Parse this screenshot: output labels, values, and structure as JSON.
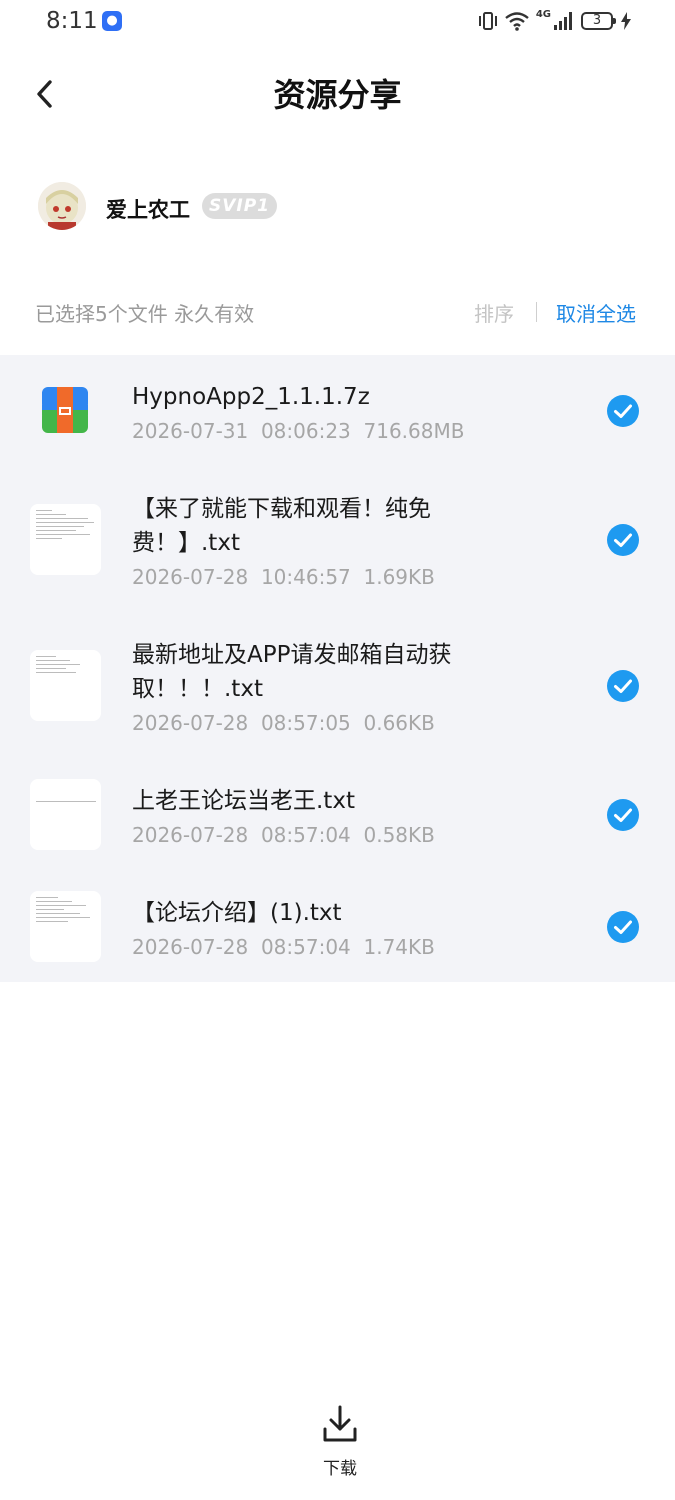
{
  "status_bar": {
    "time": "8:11",
    "network": "4G",
    "battery": "3"
  },
  "header": {
    "title": "资源分享"
  },
  "user": {
    "name": "爱上农工",
    "badge": "SVIP1"
  },
  "selection": {
    "summary": "已选择5个文件 永久有效",
    "sort_label": "排序",
    "deselect_label": "取消全选"
  },
  "files": [
    {
      "name": "HypnoApp2_1.1.1.7z",
      "date": "2026-07-31",
      "time": "08:06:23",
      "size": "716.68MB",
      "type": "archive",
      "selected": true
    },
    {
      "name": "【来了就能下载和观看！纯免费！】.txt",
      "date": "2026-07-28",
      "time": "10:46:57",
      "size": "1.69KB",
      "type": "text",
      "selected": true
    },
    {
      "name": "最新地址及APP请发邮箱自动获取！！！.txt",
      "date": "2026-07-28",
      "time": "08:57:05",
      "size": "0.66KB",
      "type": "text",
      "selected": true
    },
    {
      "name": "上老王论坛当老王.txt",
      "date": "2026-07-28",
      "time": "08:57:04",
      "size": "0.58KB",
      "type": "text",
      "selected": true
    },
    {
      "name": "【论坛介绍】(1).txt",
      "date": "2026-07-28",
      "time": "08:57:04",
      "size": "1.74KB",
      "type": "text",
      "selected": true
    }
  ],
  "bottom_bar": {
    "download_label": "下载"
  },
  "colors": {
    "accent": "#1e88e5",
    "list_background": "#f3f4f8",
    "check": "#1e9af0"
  },
  "icons": {
    "back": "chevron-left-icon",
    "check": "check-circle-icon",
    "download": "download-icon",
    "archive": "zip-archive-icon"
  }
}
